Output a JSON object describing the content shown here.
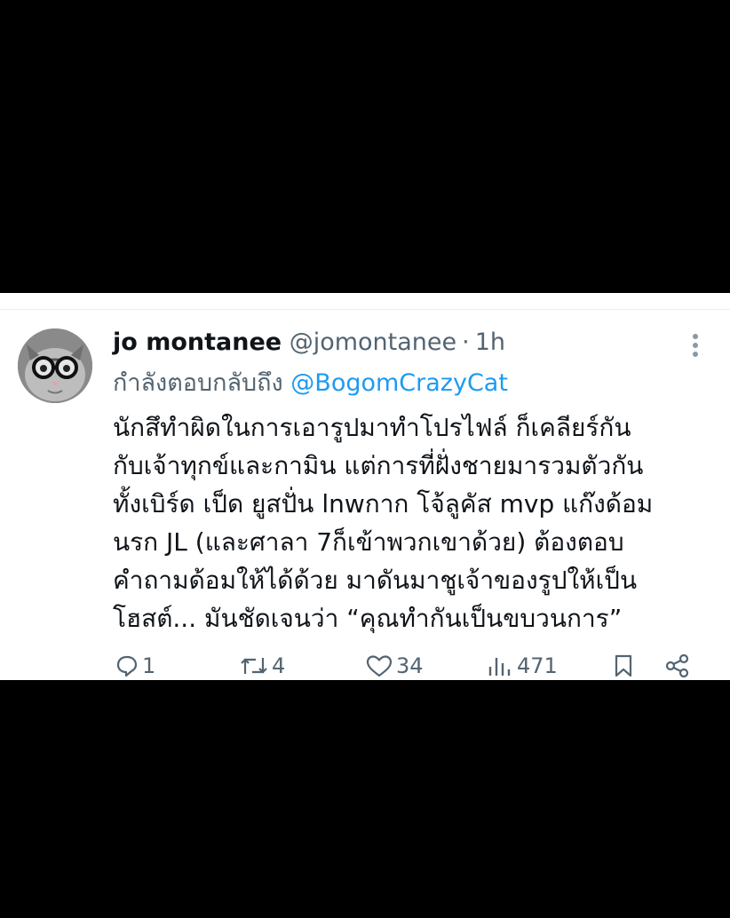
{
  "tweet": {
    "display_name": "jo montanee",
    "handle": "@jomontanee",
    "separator": "·",
    "time": "1h",
    "reply_prefix": "กำลังตอบกลับถึง",
    "reply_target": "@BogomCrazyCat",
    "text_lines": [
      "นักสึทำผิดในการเอารูปมาทำโปรไฟล์ ก็เคลียร์กัน",
      "กับเจ้าทุกข์และกามิน  แต่การที่ฝั่งชายมารวมตัวกัน",
      "ทั้งเบิร์ด เป็ด ยูสปั่น lnwกาก โจ้ลูคัส mvp แก๊งด้อม",
      "นรก JL  (และศาลา 7ก็เข้าพวกเขาด้วย)  ต้องตอบ",
      "คำถามด้อมให้ได้ด้วย มาดันมาชูเจ้าของรูปให้เป็น",
      "โฮสต์... มันชัดเจนว่า “คุณทำกันเป็นขบวนการ”"
    ]
  },
  "actions": {
    "reply_count": "1",
    "retweet_count": "4",
    "like_count": "34",
    "view_count": "471"
  },
  "icons": {
    "avatar": "cat-with-glasses-avatar",
    "more": "more-vertical-icon",
    "reply": "reply-icon",
    "retweet": "retweet-icon",
    "like": "heart-icon",
    "views": "views-bar-chart-icon",
    "bookmark": "bookmark-icon",
    "share": "share-icon"
  },
  "colors": {
    "text": "#0f1419",
    "secondary": "#536471",
    "link": "#1d9bf0",
    "background": "#ffffff",
    "letterbox": "#000000"
  }
}
